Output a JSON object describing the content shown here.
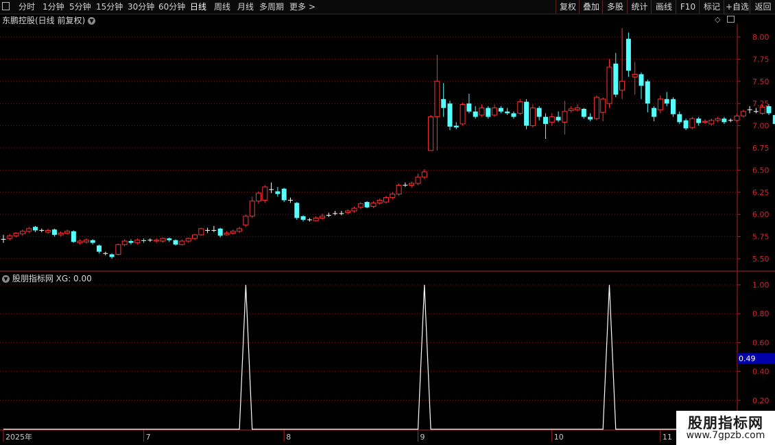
{
  "toolbar": {
    "periods": [
      "分时",
      "1分钟",
      "5分钟",
      "15分钟",
      "30分钟",
      "60分钟",
      "日线",
      "周线",
      "月线",
      "多周期",
      "更多 >"
    ],
    "active_period": "日线",
    "right_buttons": [
      "复权",
      "叠加",
      "多股",
      "统计",
      "画线",
      "F10",
      "标记",
      "+自选",
      "返回"
    ]
  },
  "main_panel": {
    "title": "东鹏控股(日线 前复权)",
    "icons": [
      "chevron-down-icon",
      "diamond-icon",
      "panel-toggle-icon"
    ]
  },
  "indicator_panel": {
    "title": "股朋指标网",
    "series_label": "XG: 0.00",
    "cursor_value": "0.49"
  },
  "x_axis_labels": [
    {
      "label": "2025年",
      "index": 0
    },
    {
      "label": "7",
      "index": 22
    },
    {
      "label": "8",
      "index": 44
    },
    {
      "label": "9",
      "index": 65
    },
    {
      "label": "10",
      "index": 86
    },
    {
      "label": "11",
      "index": 103
    }
  ],
  "watermark": {
    "line1": "股朋指标网",
    "line2": "www.7gpzb.com"
  },
  "colors": {
    "up": "#ff3232",
    "down": "#54ffff",
    "doji": "#ffffff",
    "grid": "#7a1a1a",
    "axis": "#b02020",
    "text": "#c8c8c8",
    "indicator": "#ffffff",
    "cursor_bg": "#0000a8"
  },
  "chart_data": [
    {
      "type": "candlestick",
      "title": "东鹏控股(日线 前复权)",
      "ylim": [
        5.4,
        8.2
      ],
      "yticks": [
        5.5,
        5.75,
        6.0,
        6.25,
        6.5,
        6.75,
        7.0,
        7.25,
        7.5,
        7.75,
        8.0
      ],
      "candles": [
        [
          5.72,
          5.72,
          5.77,
          5.68
        ],
        [
          5.73,
          5.76,
          5.78,
          5.71
        ],
        [
          5.76,
          5.79,
          5.8,
          5.74
        ],
        [
          5.78,
          5.81,
          5.83,
          5.76
        ],
        [
          5.81,
          5.84,
          5.86,
          5.79
        ],
        [
          5.86,
          5.82,
          5.87,
          5.8
        ],
        [
          5.82,
          5.82,
          5.84,
          5.8
        ],
        [
          5.8,
          5.82,
          5.84,
          5.78
        ],
        [
          5.83,
          5.77,
          5.84,
          5.75
        ],
        [
          5.77,
          5.79,
          5.81,
          5.75
        ],
        [
          5.79,
          5.81,
          5.83,
          5.77
        ],
        [
          5.81,
          5.69,
          5.82,
          5.68
        ],
        [
          5.68,
          5.7,
          5.72,
          5.66
        ],
        [
          5.69,
          5.71,
          5.73,
          5.67
        ],
        [
          5.71,
          5.68,
          5.72,
          5.66
        ],
        [
          5.65,
          5.58,
          5.66,
          5.56
        ],
        [
          5.56,
          5.56,
          5.58,
          5.54
        ],
        [
          5.55,
          5.52,
          5.56,
          5.5
        ],
        [
          5.55,
          5.66,
          5.67,
          5.54
        ],
        [
          5.66,
          5.7,
          5.72,
          5.64
        ],
        [
          5.7,
          5.68,
          5.72,
          5.66
        ],
        [
          5.68,
          5.71,
          5.73,
          5.66
        ],
        [
          5.71,
          5.7,
          5.73,
          5.68
        ],
        [
          5.71,
          5.71,
          5.73,
          5.69
        ],
        [
          5.7,
          5.71,
          5.73,
          5.68
        ],
        [
          5.7,
          5.73,
          5.74,
          5.68
        ],
        [
          5.73,
          5.71,
          5.74,
          5.69
        ],
        [
          5.71,
          5.66,
          5.72,
          5.65
        ],
        [
          5.66,
          5.7,
          5.72,
          5.65
        ],
        [
          5.7,
          5.73,
          5.74,
          5.68
        ],
        [
          5.73,
          5.77,
          5.78,
          5.71
        ],
        [
          5.77,
          5.84,
          5.85,
          5.76
        ],
        [
          5.82,
          5.82,
          5.85,
          5.79
        ],
        [
          5.82,
          5.82,
          5.87,
          5.8
        ],
        [
          5.84,
          5.76,
          5.85,
          5.74
        ],
        [
          5.77,
          5.79,
          5.81,
          5.76
        ],
        [
          5.79,
          5.81,
          5.83,
          5.77
        ],
        [
          5.81,
          5.84,
          5.86,
          5.79
        ],
        [
          5.88,
          5.98,
          6.0,
          5.86
        ],
        [
          5.98,
          6.15,
          6.2,
          5.96
        ],
        [
          6.15,
          6.24,
          6.26,
          6.12
        ],
        [
          6.16,
          6.31,
          6.33,
          6.13
        ],
        [
          6.28,
          6.28,
          6.36,
          6.24
        ],
        [
          6.26,
          6.23,
          6.31,
          6.2
        ],
        [
          6.29,
          6.16,
          6.3,
          6.14
        ],
        [
          6.16,
          6.16,
          6.19,
          6.13
        ],
        [
          6.13,
          5.96,
          6.14,
          5.94
        ],
        [
          5.98,
          5.94,
          5.99,
          5.92
        ],
        [
          5.94,
          5.94,
          5.96,
          5.92
        ],
        [
          5.93,
          5.96,
          5.98,
          5.92
        ],
        [
          5.96,
          5.98,
          6.01,
          5.94
        ],
        [
          5.99,
          5.99,
          6.02,
          5.97
        ],
        [
          6.01,
          6.01,
          6.04,
          5.99
        ],
        [
          6.01,
          6.01,
          6.04,
          5.99
        ],
        [
          6.02,
          6.04,
          6.06,
          6.0
        ],
        [
          6.04,
          6.07,
          6.09,
          6.02
        ],
        [
          6.08,
          6.12,
          6.14,
          6.06
        ],
        [
          6.14,
          6.08,
          6.15,
          6.07
        ],
        [
          6.09,
          6.13,
          6.15,
          6.07
        ],
        [
          6.13,
          6.16,
          6.18,
          6.11
        ],
        [
          6.14,
          6.19,
          6.21,
          6.12
        ],
        [
          6.19,
          6.23,
          6.25,
          6.17
        ],
        [
          6.23,
          6.33,
          6.35,
          6.21
        ],
        [
          6.33,
          6.33,
          6.36,
          6.31
        ],
        [
          6.33,
          6.35,
          6.37,
          6.3
        ],
        [
          6.35,
          6.42,
          6.46,
          6.33
        ],
        [
          6.42,
          6.48,
          6.51,
          6.4
        ],
        [
          6.72,
          7.1,
          7.12,
          6.72
        ],
        [
          7.1,
          7.5,
          7.8,
          6.72
        ],
        [
          7.3,
          7.2,
          7.48,
          7.1
        ],
        [
          7.25,
          6.99,
          7.28,
          6.95
        ],
        [
          7.0,
          6.98,
          7.04,
          6.96
        ],
        [
          7.02,
          7.24,
          7.26,
          7.0
        ],
        [
          7.25,
          7.16,
          7.36,
          7.14
        ],
        [
          7.16,
          7.1,
          7.22,
          7.08
        ],
        [
          7.12,
          7.2,
          7.24,
          7.1
        ],
        [
          7.2,
          7.1,
          7.22,
          7.08
        ],
        [
          7.12,
          7.2,
          7.24,
          7.1
        ],
        [
          7.2,
          7.16,
          7.22,
          7.14
        ],
        [
          7.16,
          7.14,
          7.2,
          7.12
        ],
        [
          7.14,
          7.1,
          7.16,
          7.08
        ],
        [
          7.14,
          7.27,
          7.3,
          7.12
        ],
        [
          7.27,
          7.0,
          7.3,
          6.96
        ],
        [
          7.0,
          7.2,
          7.24,
          6.98
        ],
        [
          7.2,
          7.1,
          7.22,
          7.06
        ],
        [
          7.1,
          7.02,
          7.14,
          6.85
        ],
        [
          7.04,
          7.1,
          7.14,
          7.0
        ],
        [
          7.1,
          7.06,
          7.16,
          7.04
        ],
        [
          7.04,
          7.16,
          7.28,
          6.9
        ],
        [
          7.17,
          7.19,
          7.22,
          7.15
        ],
        [
          7.18,
          7.2,
          7.24,
          7.16
        ],
        [
          7.19,
          7.1,
          7.2,
          7.08
        ],
        [
          7.1,
          7.07,
          7.14,
          7.05
        ],
        [
          7.08,
          7.32,
          7.34,
          7.06
        ],
        [
          7.15,
          7.3,
          7.32,
          7.05
        ],
        [
          7.25,
          7.66,
          7.75,
          7.2
        ],
        [
          7.7,
          7.35,
          7.82,
          7.32
        ],
        [
          7.4,
          7.5,
          8.1,
          7.3
        ],
        [
          7.98,
          7.62,
          8.05,
          7.55
        ],
        [
          7.55,
          7.58,
          7.72,
          7.35
        ],
        [
          7.58,
          7.45,
          7.6,
          7.3
        ],
        [
          7.5,
          7.25,
          7.52,
          7.15
        ],
        [
          7.2,
          7.1,
          7.22,
          7.05
        ],
        [
          7.18,
          7.3,
          7.34,
          7.14
        ],
        [
          7.3,
          7.25,
          7.38,
          7.22
        ],
        [
          7.3,
          7.13,
          7.32,
          7.1
        ],
        [
          7.13,
          7.04,
          7.16,
          7.02
        ],
        [
          7.06,
          6.97,
          7.08,
          6.95
        ],
        [
          6.98,
          7.08,
          7.1,
          6.96
        ],
        [
          7.08,
          7.03,
          7.1,
          7.0
        ],
        [
          7.04,
          7.05,
          7.07,
          7.02
        ],
        [
          7.02,
          7.06,
          7.08,
          7.0
        ],
        [
          7.06,
          7.08,
          7.1,
          7.04
        ],
        [
          7.08,
          7.04,
          7.1,
          7.02
        ],
        [
          7.06,
          7.06,
          7.08,
          7.04
        ],
        [
          7.06,
          7.11,
          7.13,
          7.04
        ],
        [
          7.11,
          7.16,
          7.18,
          7.09
        ],
        [
          7.18,
          7.18,
          7.22,
          7.14
        ],
        [
          7.16,
          7.16,
          7.2,
          7.14
        ],
        [
          7.14,
          7.21,
          7.24,
          7.12
        ],
        [
          7.22,
          7.14,
          7.24,
          7.12
        ],
        [
          7.12,
          7.02,
          7.14,
          7.0
        ]
      ]
    },
    {
      "type": "line",
      "title": "股朋指标网",
      "ylim": [
        0,
        1.1
      ],
      "yticks": [
        0.2,
        0.4,
        0.6,
        0.8,
        1.0
      ],
      "spikes_at_index": [
        38,
        66,
        95
      ],
      "values_rule": "1 at spike index, 0 elsewhere"
    }
  ]
}
